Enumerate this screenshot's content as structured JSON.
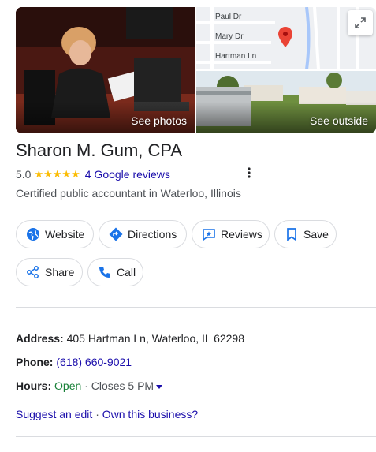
{
  "media": {
    "see_photos_label": "See photos",
    "see_outside_label": "See outside",
    "map_streets": [
      "Paul Dr",
      "Mary Dr",
      "Hartman Ln"
    ]
  },
  "business": {
    "name": "Sharon M. Gum, CPA",
    "rating": "5.0",
    "stars": "★★★★★",
    "reviews_label": "4 Google reviews",
    "category": "Certified public accountant in Waterloo, Illinois"
  },
  "actions": {
    "website": "Website",
    "directions": "Directions",
    "reviews": "Reviews",
    "save": "Save",
    "share": "Share",
    "call": "Call"
  },
  "details": {
    "address_label": "Address:",
    "address_value": "405 Hartman Ln, Waterloo, IL 62298",
    "phone_label": "Phone:",
    "phone_value": "(618) 660-9021",
    "hours_label": "Hours:",
    "hours_status": "Open",
    "hours_sep": "·",
    "hours_close": "Closes 5 PM"
  },
  "footer": {
    "suggest_edit": "Suggest an edit",
    "sep": "·",
    "own_business": "Own this business?"
  },
  "colors": {
    "link": "#1a0dab",
    "open": "#188038",
    "star": "#fbbc04",
    "icon_blue": "#1a73e8",
    "map_pin": "#ea4335"
  }
}
